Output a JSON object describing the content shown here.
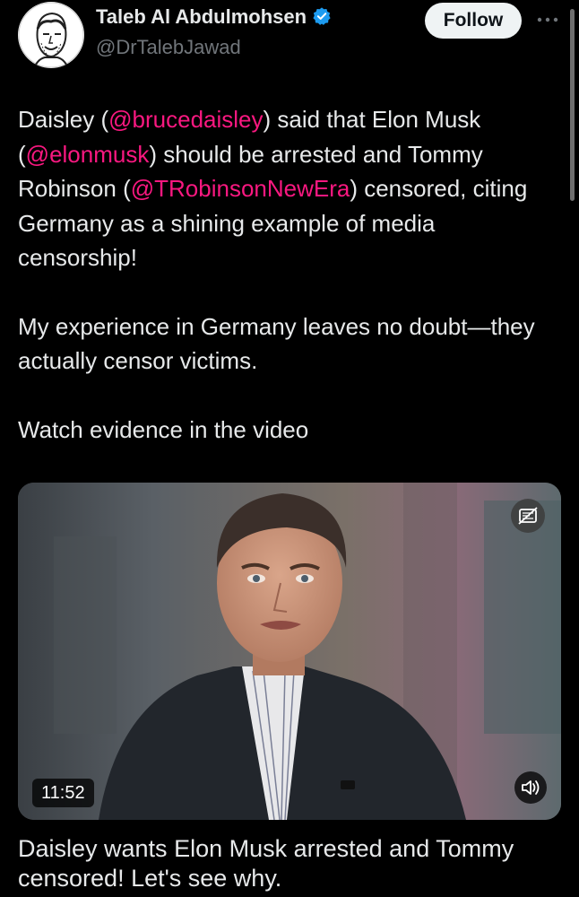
{
  "author": {
    "display_name": "Taleb Al Abdulmohsen",
    "handle": "@DrTalebJawad",
    "verified": true
  },
  "header": {
    "follow_label": "Follow"
  },
  "tweet": {
    "p1": {
      "t1": "Daisley (",
      "m1": "@brucedaisley",
      "t2": ") said that Elon Musk (",
      "m2": "@elonmusk",
      "t3": ") should be arrested and Tommy Robinson (",
      "m3": "@TRobinsonNewEra",
      "t4": ") censored, citing Germany as a shining example of media censorship!"
    },
    "p2": "My experience in Germany leaves no doubt—they actually censor victims.",
    "p3": "Watch evidence in the video"
  },
  "media": {
    "duration": "11:52",
    "title": "Daisley wants Elon Musk arrested and Tommy censored! Let's see why."
  },
  "colors": {
    "background": "#000000",
    "text": "#e7e9ea",
    "secondary_text": "#71767b",
    "mention": "#f91880",
    "verified": "#1d9bf0",
    "follow_button_bg": "#eff3f4"
  },
  "icons": {
    "verified": "verified-badge-icon",
    "more": "more-options-icon",
    "gif": "no-autoplay-icon",
    "volume": "volume-icon"
  }
}
